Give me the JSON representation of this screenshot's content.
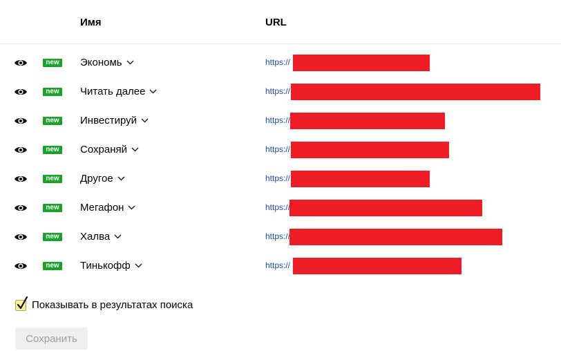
{
  "header": {
    "name_col": "Имя",
    "url_col": "URL"
  },
  "rows": [
    {
      "badge": "new",
      "name": "Экономь",
      "url": "https://"
    },
    {
      "badge": "new",
      "name": "Читать далее",
      "url": "https://"
    },
    {
      "badge": "new",
      "name": "Инвестируй",
      "url": "https://"
    },
    {
      "badge": "new",
      "name": "Сохраняй",
      "url": "https://"
    },
    {
      "badge": "new",
      "name": "Другое",
      "url": "https://"
    },
    {
      "badge": "new",
      "name": "Мегафон",
      "url": "https://"
    },
    {
      "badge": "new",
      "name": "Халва",
      "url": "https://"
    },
    {
      "badge": "new",
      "name": "Тинькофф",
      "url": "https://"
    }
  ],
  "show_in_search": {
    "label": "Показывать в результатах поиска",
    "checked": true
  },
  "save_button": {
    "label": "Сохранить",
    "disabled": true
  },
  "colors": {
    "badge_bg": "#1aa32a",
    "link": "#1a4ea5",
    "redaction": "#ee1d25",
    "checkbox_bg": "#ffeaa0"
  },
  "icons": {
    "visibility": "eye-icon",
    "dropdown": "chevron-down-icon",
    "check": "checkmark-icon"
  }
}
